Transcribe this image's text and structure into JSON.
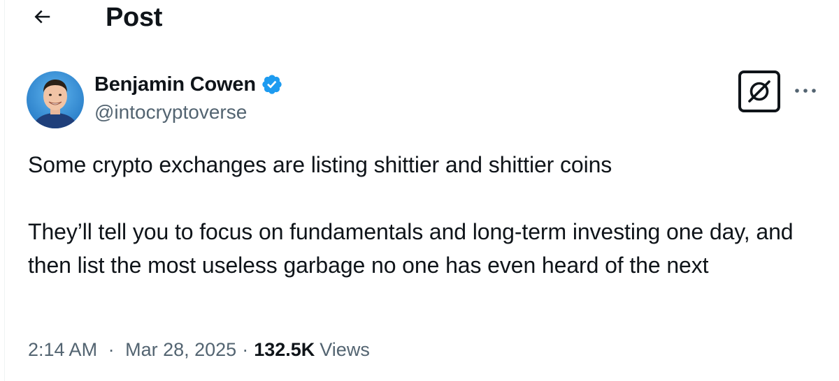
{
  "header": {
    "title": "Post",
    "back_icon": "arrow-left-icon"
  },
  "author": {
    "name": "Benjamin Cowen",
    "handle": "@intocryptoverse",
    "verified": true,
    "verified_color": "#1d9bf0",
    "avatar_icon": "avatar-photo"
  },
  "actions": {
    "grok_icon": "grok-icon",
    "more_icon": "more-horizontal-icon"
  },
  "post": {
    "paragraphs": [
      "Some crypto exchanges are listing shittier and shittier coins",
      "They’ll tell you to focus on fundamentals and long-term investing one day, and then list the most useless garbage no one has even heard of the next"
    ]
  },
  "meta": {
    "time": "2:14 AM",
    "separator": "·",
    "date": "Mar 28, 2025",
    "views_count": "132.5K",
    "views_label": "Views"
  },
  "colors": {
    "text": "#0f1419",
    "secondary": "#536471",
    "border": "#eff3f4"
  }
}
